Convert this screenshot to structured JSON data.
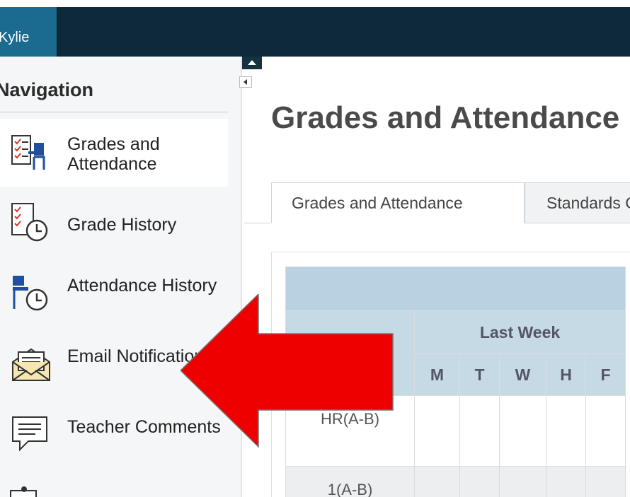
{
  "header": {
    "user_name": "Kylie"
  },
  "sidebar": {
    "heading": "Navigation",
    "items": [
      {
        "label": "Grades and Attendance",
        "icon": "grades-attendance-icon",
        "active": true
      },
      {
        "label": "Grade History",
        "icon": "grade-history-icon"
      },
      {
        "label": "Attendance History",
        "icon": "attendance-history-icon"
      },
      {
        "label": "Email Notification",
        "icon": "email-notification-icon"
      },
      {
        "label": "Teacher Comments",
        "icon": "teacher-comments-icon"
      }
    ]
  },
  "main": {
    "title": "Grades and Attendance",
    "tabs": [
      {
        "label": "Grades and Attendance",
        "active": true
      },
      {
        "label": "Standards Grades"
      }
    ],
    "table": {
      "week_label": "Last Week",
      "days": [
        "M",
        "T",
        "W",
        "H",
        "F"
      ],
      "rows": [
        {
          "period": "HR(A-B)"
        },
        {
          "period": "1(A-B)"
        }
      ]
    }
  },
  "annotation": {
    "arrow_color": "#ee0000",
    "arrow_target": "Email Notification"
  },
  "colors": {
    "topbar": "#0e2a3a",
    "user_tab": "#1a6b8f",
    "table_header": "#b9d1e0"
  }
}
